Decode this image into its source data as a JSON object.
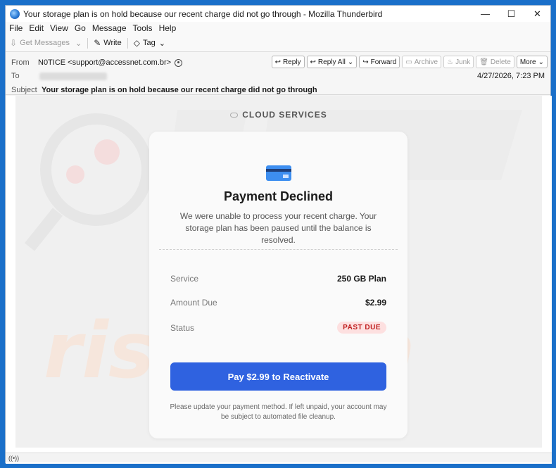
{
  "window": {
    "title": "Your storage plan is on hold because our recent charge did not go through - Mozilla Thunderbird",
    "controls": {
      "minimize": "—",
      "maximize": "☐",
      "close": "✕"
    }
  },
  "menu": {
    "items": [
      "File",
      "Edit",
      "View",
      "Go",
      "Message",
      "Tools",
      "Help"
    ]
  },
  "toolbar": {
    "get_messages": "Get Messages",
    "write": "Write",
    "tag": "Tag"
  },
  "header": {
    "from_label": "From",
    "from_value": "N0TICE <support@accessnet.com.br>",
    "to_label": "To",
    "subject_label": "Subject",
    "subject_value": "Your storage plan is on hold because our recent charge did not go through",
    "date": "4/27/2026, 7:23 PM",
    "actions": {
      "reply": "Reply",
      "reply_all": "Reply All",
      "forward": "Forward",
      "archive": "Archive",
      "junk": "Junk",
      "delete": "Delete",
      "more": "More"
    }
  },
  "email": {
    "brand": "CLOUD SERVICES",
    "title": "Payment Declined",
    "message": "We were unable to process your recent charge. Your storage plan has been paused until the balance is resolved.",
    "service_label": "Service",
    "service_value": "250 GB Plan",
    "amount_label": "Amount Due",
    "amount_value": "$2.99",
    "status_label": "Status",
    "status_value": "PAST DUE",
    "cta": "Pay $2.99 to Reactivate",
    "footnote": "Please update your payment method. If left unpaid, your account may be subject to automated file cleanup."
  },
  "colors": {
    "accent": "#2f62e0",
    "badge_bg": "#fde0e0",
    "badge_text": "#c02020",
    "titlebar_frame": "#1a6fc9"
  }
}
